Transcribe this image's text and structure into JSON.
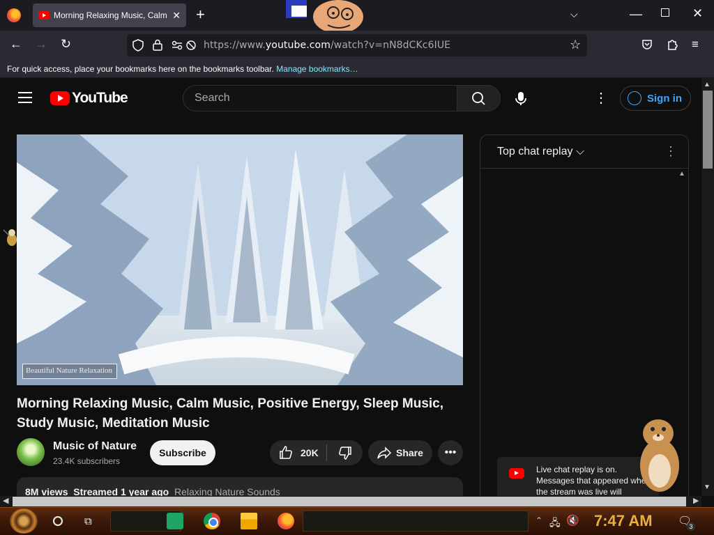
{
  "browser": {
    "tab_title": "Morning Relaxing Music, Calm",
    "tab_close": "✕",
    "new_tab": "+",
    "url_prefix": "https://www.",
    "url_domain": "youtube.com",
    "url_path": "/watch?v=nN8dCKc6IUE",
    "bookmarks_text": "For quick access, place your bookmarks here on the bookmarks toolbar.",
    "bookmarks_link": "Manage bookmarks…"
  },
  "youtube": {
    "logo_text": "YouTube",
    "search_placeholder": "Search",
    "sign_in": "Sign in"
  },
  "video": {
    "watermark": "Beautiful Nature Relaxation",
    "title": "Morning Relaxing Music, Calm Music, Positive Energy, Sleep Music, Study Music, Meditation Music",
    "channel_name": "Music of Nature",
    "subscribers": "23.4K subscribers",
    "subscribe_label": "Subscribe",
    "likes": "20K",
    "share_label": "Share",
    "views": "8M views",
    "streamed": "Streamed 1 year ago",
    "tag": "Relaxing Nature Sounds"
  },
  "chat": {
    "title": "Top chat replay",
    "notice": "Live chat replay is on. Messages that appeared when the stream was live will"
  },
  "taskbar": {
    "clock": "7:47 AM",
    "notification_count": "3"
  },
  "colors": {
    "youtube_red": "#ff0000",
    "link_blue": "#3ea6ff",
    "clock_gold": "#e8b040"
  }
}
